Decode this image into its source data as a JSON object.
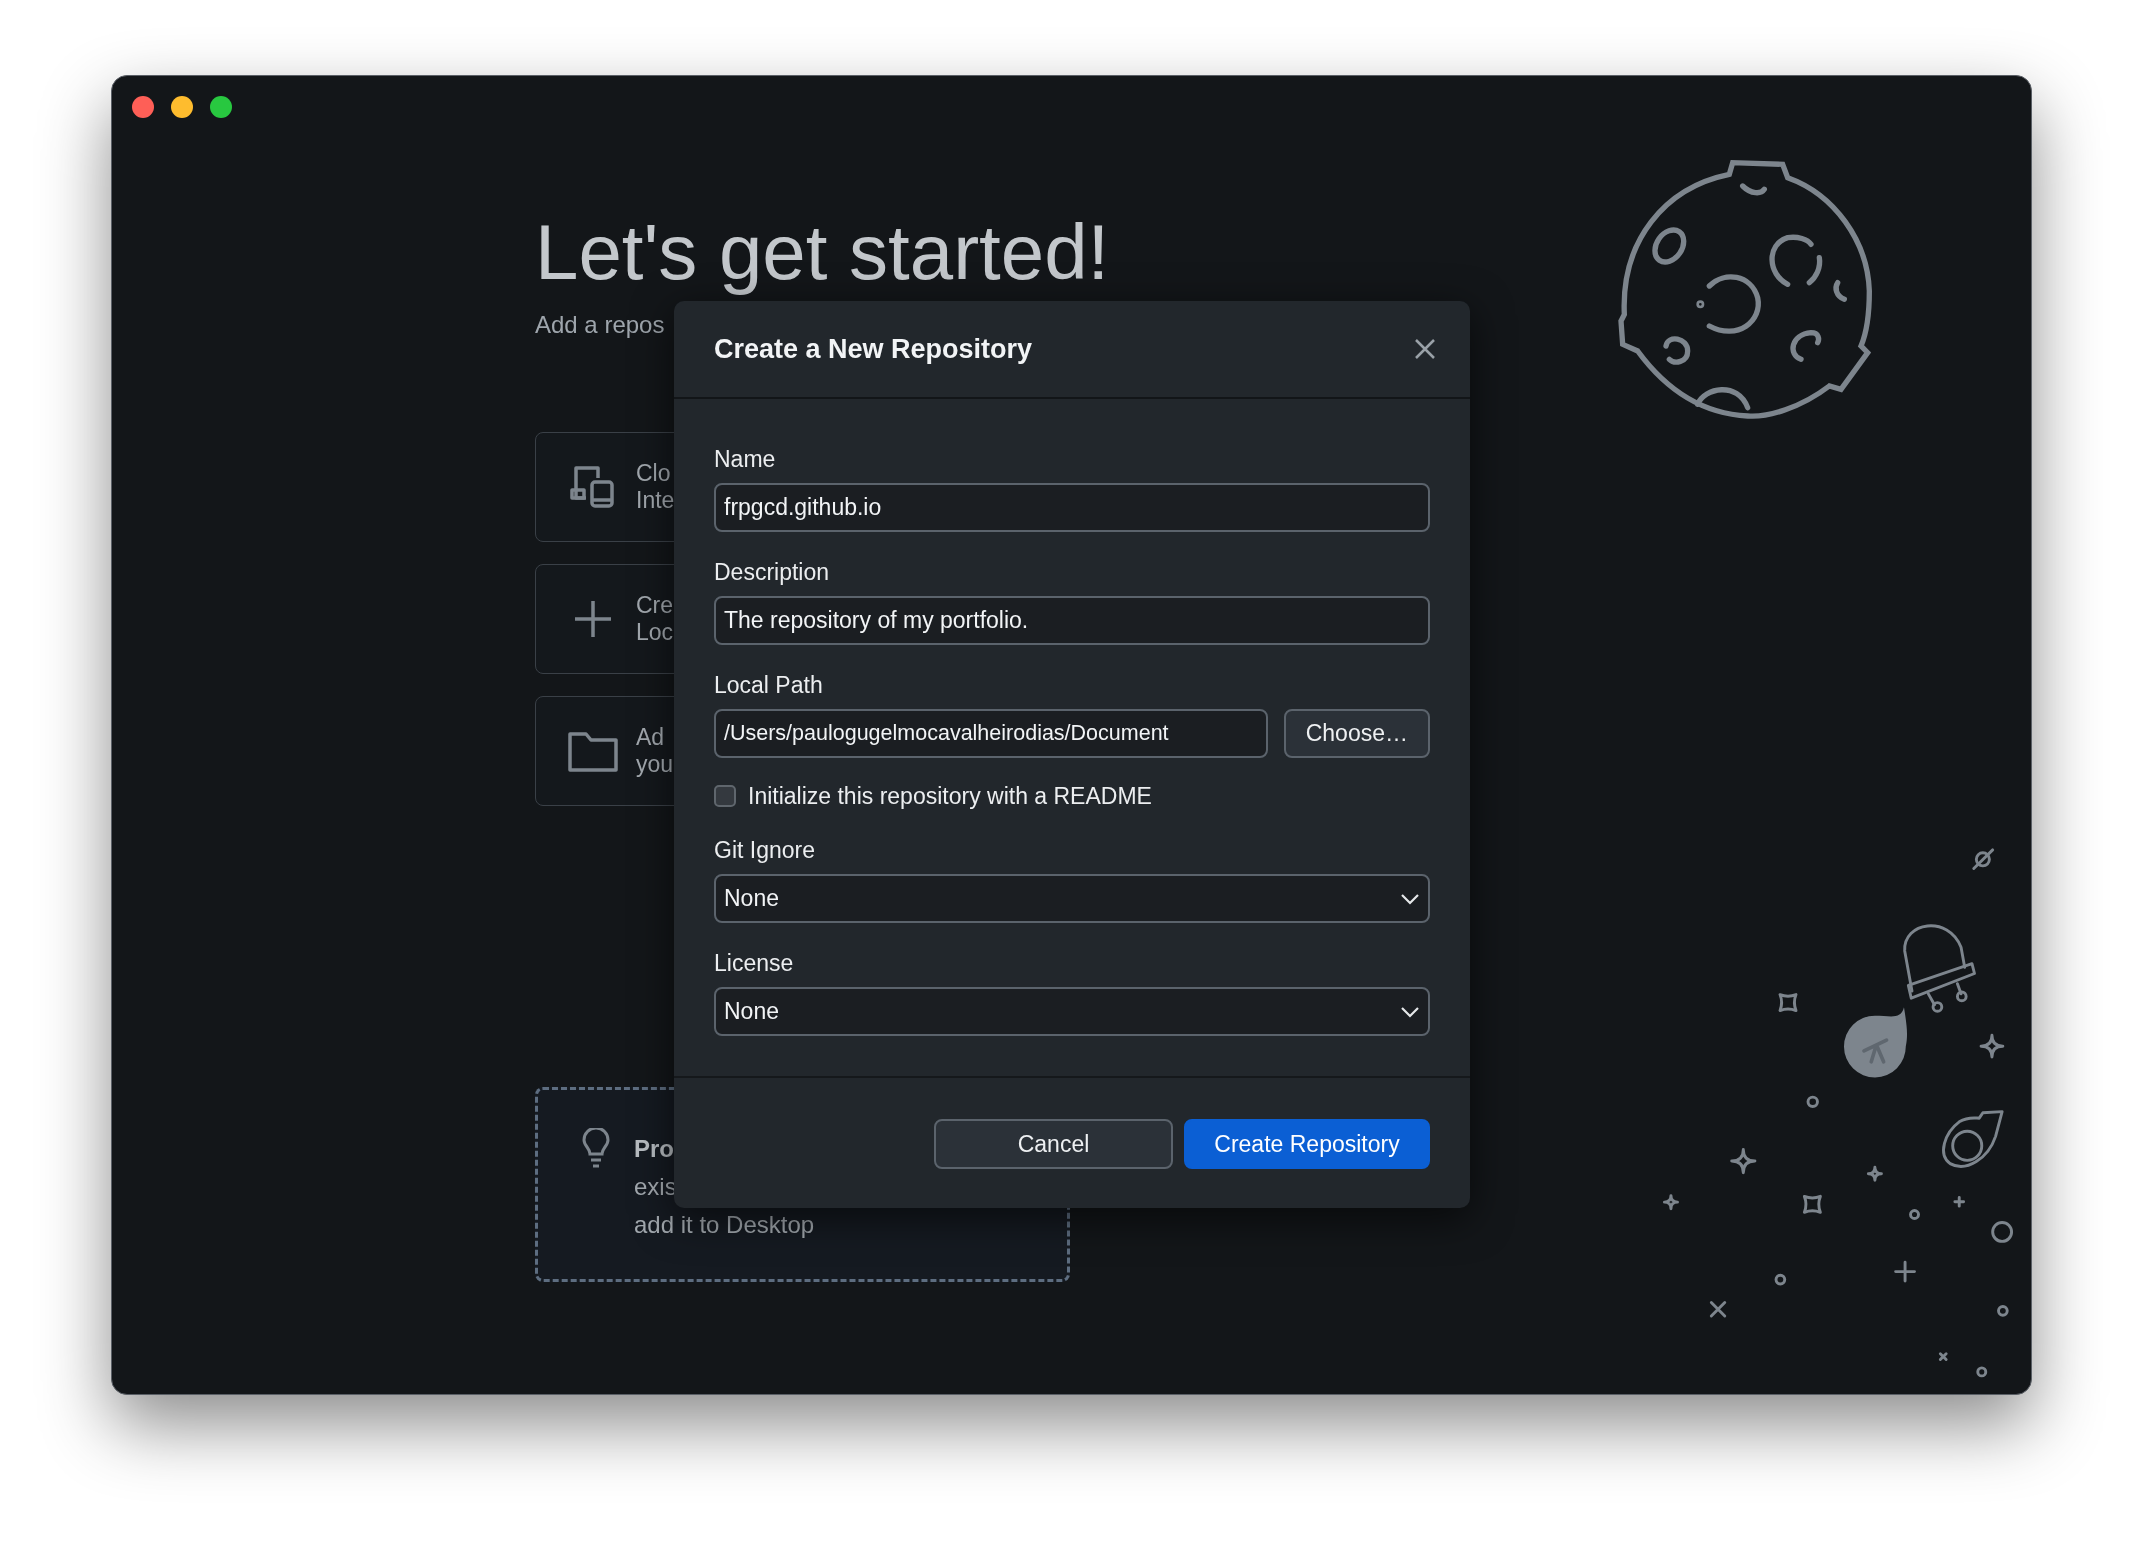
{
  "welcome": {
    "title": "Let's get started!",
    "subtitle": "Add a repos",
    "actions": [
      {
        "kind": "clone",
        "lines": [
          "Clo",
          "Inte"
        ]
      },
      {
        "kind": "create",
        "lines": [
          "Cre",
          "Loc"
        ]
      },
      {
        "kind": "add",
        "lines": [
          "Ad",
          "you"
        ]
      }
    ],
    "tip": {
      "lines": [
        "Pro",
        "exis",
        "add it to Desktop"
      ]
    }
  },
  "dialog": {
    "title": "Create a New Repository",
    "fields": [
      {
        "kind": "text",
        "label": "Name",
        "value": "frpgcd.github.io"
      },
      {
        "kind": "text",
        "label": "Description",
        "value": "The repository of my portfolio."
      },
      {
        "kind": "path",
        "label": "Local Path",
        "value": "/Users/paulogugelmocavalheirodias/Document",
        "button": "Choose…"
      },
      {
        "kind": "checkbox",
        "label": "Initialize this repository with a README",
        "checked": false
      },
      {
        "kind": "select",
        "label": "Git Ignore",
        "value": "None"
      },
      {
        "kind": "select",
        "label": "License",
        "value": "None"
      }
    ],
    "buttons": [
      {
        "label": "Cancel",
        "primary": false
      },
      {
        "label": "Create Repository",
        "primary": true
      }
    ]
  }
}
